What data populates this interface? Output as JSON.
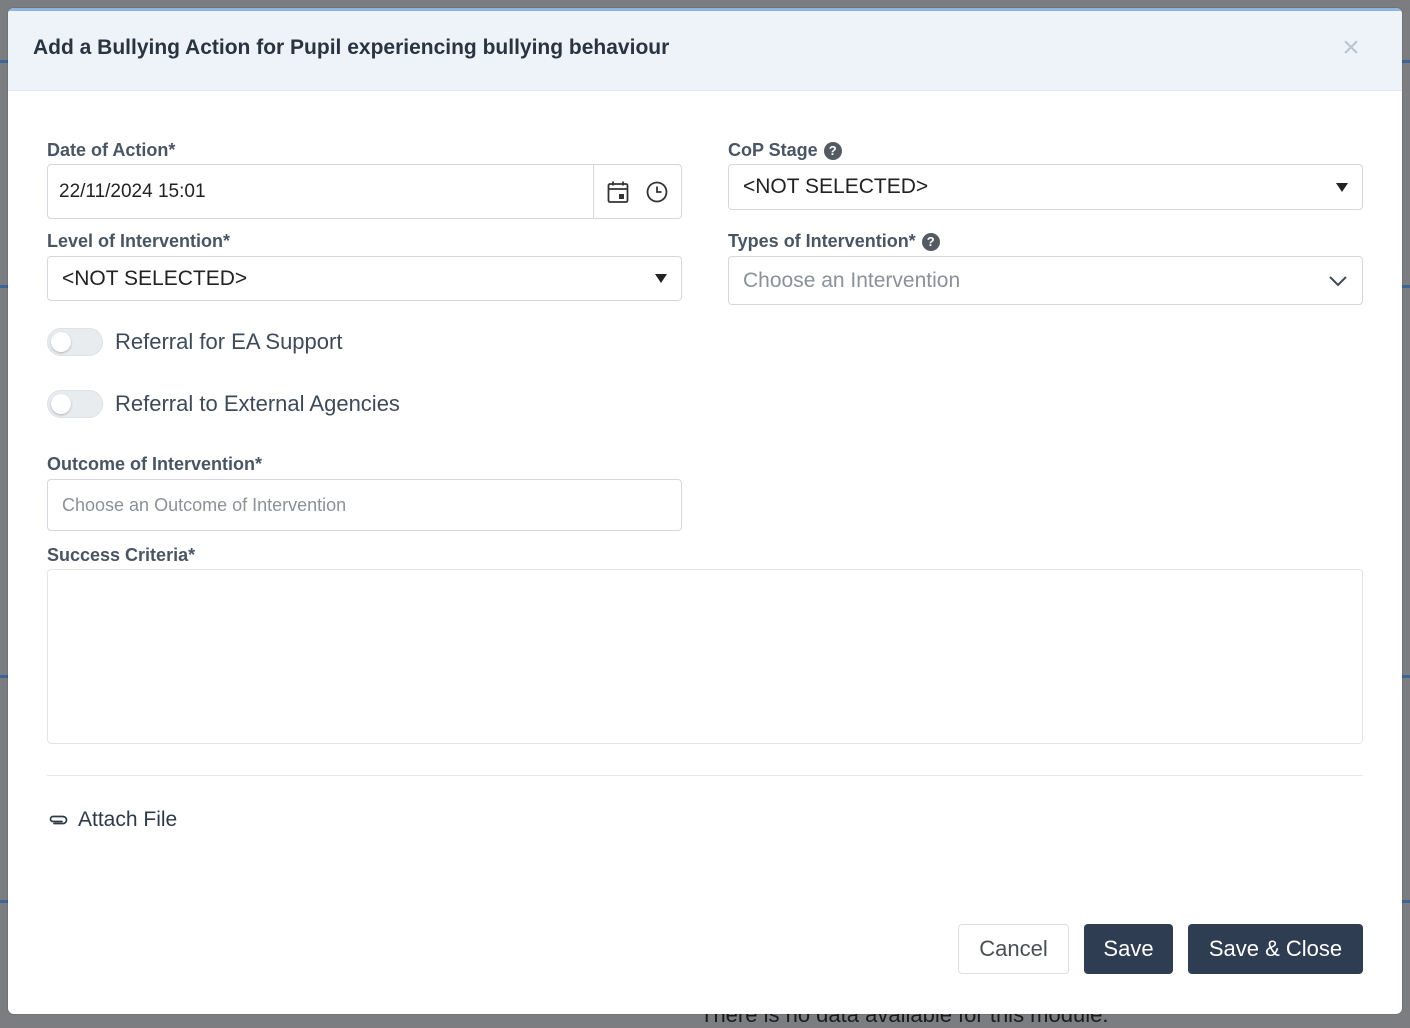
{
  "dialog": {
    "title": "Add a Bullying Action for Pupil experiencing bullying behaviour",
    "close_glyph": "×"
  },
  "form": {
    "date_of_action": {
      "label": "Date of Action*",
      "value": "22/11/2024 15:01"
    },
    "cop_stage": {
      "label": "CoP Stage",
      "value": "<NOT SELECTED>",
      "help": "?"
    },
    "level_of_intervention": {
      "label": "Level of Intervention*",
      "value": "<NOT SELECTED>"
    },
    "types_of_intervention": {
      "label": "Types of Intervention*",
      "placeholder": "Choose an Intervention",
      "help": "?"
    },
    "referral_ea_support": {
      "label": "Referral for EA Support",
      "checked": false
    },
    "referral_external_agencies": {
      "label": "Referral to External Agencies",
      "checked": false
    },
    "outcome_of_intervention": {
      "label": "Outcome of Intervention*",
      "placeholder": "Choose an Outcome of Intervention"
    },
    "success_criteria": {
      "label": "Success Criteria*",
      "value": ""
    },
    "attach_file": {
      "label": "Attach File"
    }
  },
  "footer": {
    "cancel_label": "Cancel",
    "save_label": "Save",
    "save_close_label": "Save & Close"
  },
  "background": {
    "partial_text": "There is no data available for this module."
  },
  "colors": {
    "primary_button": "#2e3d52",
    "header_bg": "#eef3f9",
    "label_text": "#4a5564"
  }
}
